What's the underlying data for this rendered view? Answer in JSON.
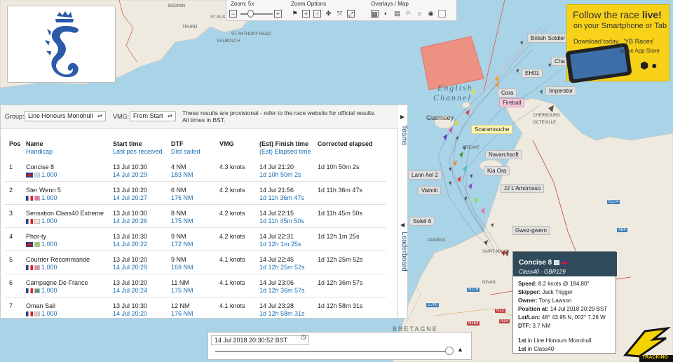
{
  "map": {
    "places": [
      "ST ANTHONY HEAD",
      "ST AUSTELL",
      "BODMIN",
      "TRURO",
      "FALMOUTH"
    ],
    "channel": [
      "English",
      "Channel"
    ],
    "region": "BRETAGNE",
    "islands": [
      "Guernsey"
    ],
    "towns": [
      "Cherbourg",
      "Octeville",
      "Brehat",
      "Paimpol",
      "Saint-Malo",
      "Dinan"
    ],
    "roads": [
      "N174",
      "A84",
      "N176",
      "D700",
      "N164",
      "N12",
      "N24",
      "E3"
    ]
  },
  "toolbar": {
    "zoom_title": "Zoom: 5x",
    "zoom_minus": "−",
    "zoom_plus": "+",
    "zoom_options_title": "Zoom Options",
    "overlays_title": "Overlays / Map"
  },
  "ad": {
    "line1_a": "Follow the race ",
    "line1_b": "live!",
    "line2": "on your Smartphone or Tab",
    "line3": "Download today...'YB Races'",
    "line4": "in the App Store"
  },
  "filter": {
    "group_label": "Group:",
    "group_value": "Line Honours Monohull",
    "vmg_label": "VMG:",
    "vmg_value": "From Start",
    "notice_1": "These results are provisional - refer to the race website for official results.",
    "notice_2": "All times in BST."
  },
  "table": {
    "headers": {
      "pos": "Pos",
      "name": "Name",
      "handicap": "Handicap",
      "start": "Start time",
      "last_pos": "Last pos received",
      "dtf": "DTF",
      "dist_sailed": "Dist sailed",
      "vmg": "VMG",
      "finish": "(Est) Finish time",
      "elapsed": "(Est) Elapsed time",
      "corrected": "Corrected elapsed"
    },
    "rows": [
      {
        "pos": "1",
        "name": "Concise 8",
        "flag": "uk",
        "swatch": "#bfe3ea",
        "handicap": "1.000",
        "start": "13 Jul 10:30",
        "last": "14 Jul 20:29",
        "dtf": "4 NM",
        "sailed": "183 NM",
        "vmg": "4.3 knots",
        "finish": "14 Jul 21:20",
        "elapsed": "1d 10h 50m 2s",
        "corrected": "1d 10h 50m 2s"
      },
      {
        "pos": "2",
        "name": "Ster Wenn 5",
        "flag": "fr",
        "swatch": "#e86fa8",
        "handicap": "1.000",
        "start": "13 Jul 10:20",
        "last": "14 Jul 20:27",
        "dtf": "6 NM",
        "sailed": "176 NM",
        "vmg": "4.2 knots",
        "finish": "14 Jul 21:56",
        "elapsed": "1d 11h 36m 47s",
        "corrected": "1d 11h 36m 47s"
      },
      {
        "pos": "3",
        "name": "Sensation Class40 Extreme",
        "flag": "fr",
        "swatch": "#fbe5d0",
        "handicap": "1.000",
        "start": "13 Jul 10:30",
        "last": "14 Jul 20:26",
        "dtf": "8 NM",
        "sailed": "175 NM",
        "vmg": "4.2 knots",
        "finish": "14 Jul 22:15",
        "elapsed": "1d 11h 45m 50s",
        "corrected": "1d 11h 45m 50s"
      },
      {
        "pos": "4",
        "name": "Phor-ty",
        "flag": "uk",
        "swatch": "#8ed84a",
        "handicap": "1.000",
        "start": "13 Jul 10:30",
        "last": "14 Jul 20:22",
        "dtf": "9 NM",
        "sailed": "172 NM",
        "vmg": "4.2 knots",
        "finish": "14 Jul 22:31",
        "elapsed": "1d 12h 1m 25s",
        "corrected": "1d 12h 1m 25s"
      },
      {
        "pos": "5",
        "name": "Courrier Recommande",
        "flag": "fr",
        "swatch": "#e88aa8",
        "handicap": "1.000",
        "start": "13 Jul 10:20",
        "last": "14 Jul 20:29",
        "dtf": "9 NM",
        "sailed": "169 NM",
        "vmg": "4.1 knots",
        "finish": "14 Jul 22:45",
        "elapsed": "1d 12h 25m 52s",
        "corrected": "1d 12h 25m 52s"
      },
      {
        "pos": "6",
        "name": "Campagne De France",
        "flag": "fr",
        "swatch": "#4f9a86",
        "handicap": "1.000",
        "start": "13 Jul 10:20",
        "last": "14 Jul 20:24",
        "dtf": "11 NM",
        "sailed": "175 NM",
        "vmg": "4.1 knots",
        "finish": "14 Jul 23:06",
        "elapsed": "1d 12h 36m 57s",
        "corrected": "1d 12h 36m 57s"
      },
      {
        "pos": "7",
        "name": "Oman Sail",
        "flag": "fr",
        "swatch": "#cfcfcf",
        "handicap": "1.000",
        "start": "13 Jul 10:30",
        "last": "14 Jul 20:20",
        "dtf": "12 NM",
        "sailed": "176 NM",
        "vmg": "4.1 knots",
        "finish": "14 Jul 23:28",
        "elapsed": "1d 12h 58m 31s",
        "corrected": "1d 12h 58m 31s"
      }
    ]
  },
  "tabs": {
    "teams": "Teams",
    "leaderboard": "Leaderboard"
  },
  "boats": [
    "British Soldier",
    "Cha",
    "EH01",
    "Imperator",
    "Cora",
    "Fireball",
    "Scaramouche",
    "Navarchsoft",
    "Kia Ora",
    "Lann Ael 2",
    "JJ L'Amorosso",
    "Vaimiti",
    "Soleil 6",
    "Gwez-gwern"
  ],
  "popup": {
    "name": "Concise 8",
    "class": "Class40 - GBR129",
    "speed_label": "Speed:",
    "speed_value": "8.2 knots @ 184.80°",
    "skipper_label": "Skipper:",
    "skipper_value": "Jack Trigger",
    "owner_label": "Owner:",
    "owner_value": "Tony Lawson",
    "position_label": "Position at:",
    "position_value": "14 Jul 2018 20:29 BST",
    "latlon_label": "Lat/Lon:",
    "latlon_value": "48° 43.95 N, 002° 7.28 W",
    "dtf_label": "DTF:",
    "dtf_value": "3.7 NM",
    "rank1_a": "1st",
    "rank1_b": " in Line Honours Monohull",
    "rank2_a": "1st",
    "rank2_b": " in Class40"
  },
  "timeline": {
    "datetime": "14 Jul 2018 20:30:52 BST"
  },
  "brand": {
    "tracking": "TRACKING"
  },
  "colors": {
    "sea": "#a9d3e6",
    "land": "#eeeadf",
    "zone": "#f58a78",
    "panel_header": "#2f4a5a",
    "link_blue": "#1b6fb4",
    "ad_yellow": "#f8d119"
  }
}
